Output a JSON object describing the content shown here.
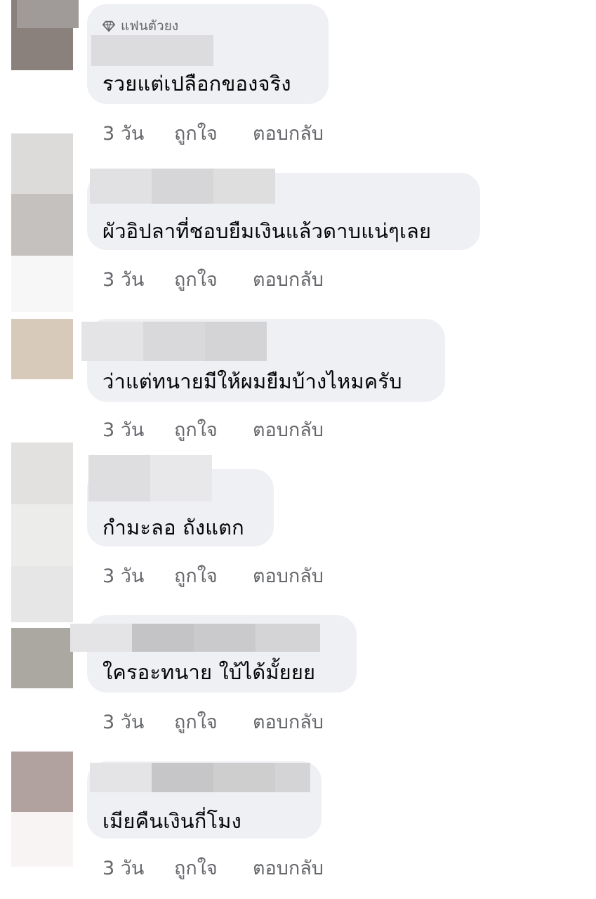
{
  "badge_label": "แฟนตัวยง",
  "comments": [
    {
      "text": "รวยแต่เปลือกของจริง",
      "time": "3 วัน",
      "like": "ถูกใจ",
      "reply": "ตอบกลับ"
    },
    {
      "text": "ผัวอิปลาที่ชอบยืมเงินแล้วดาบแน่ๆเลย",
      "time": "3 วัน",
      "like": "ถูกใจ",
      "reply": "ตอบกลับ"
    },
    {
      "text": "ว่าแต่ทนายมีให้ผมยืมบ้างไหมครับ",
      "time": "3 วัน",
      "like": "ถูกใจ",
      "reply": "ตอบกลับ"
    },
    {
      "text": "กำมะลอ ถังแตก",
      "time": "3 วัน",
      "like": "ถูกใจ",
      "reply": "ตอบกลับ"
    },
    {
      "text": "ใครอะทนาย ใบ้ได้มั้ยยย",
      "time": "3 วัน",
      "like": "ถูกใจ",
      "reply": "ตอบกลับ"
    },
    {
      "text": "เมียคืนเงินกี่โมง",
      "time": "3 วัน",
      "like": "ถูกใจ",
      "reply": "ตอบกลับ"
    }
  ]
}
